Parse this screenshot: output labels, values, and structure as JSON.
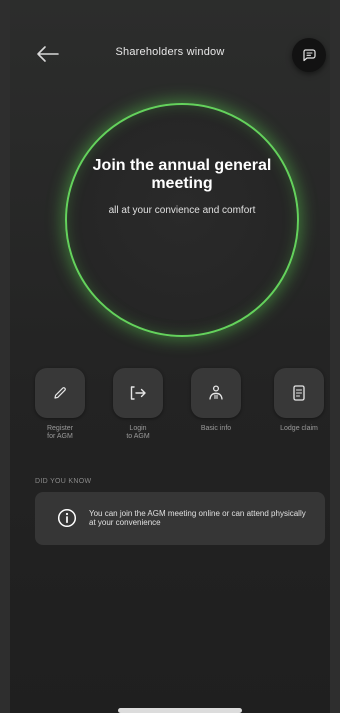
{
  "header": {
    "title": "Shareholders window",
    "back_icon": "arrow-left-icon",
    "chat_icon": "message-square-icon"
  },
  "hero": {
    "title": "Join the annual general meeting",
    "subtitle": "all at your convience and comfort",
    "ring_color": "#64d25c"
  },
  "actions": [
    {
      "label": "Register\nfor AGM",
      "icon": "pencil-icon"
    },
    {
      "label": "Login\nto AGM",
      "icon": "login-arrow-icon"
    },
    {
      "label": "Basic info",
      "icon": "user-info-icon"
    },
    {
      "label": "Lodge claim",
      "icon": "document-icon"
    }
  ],
  "did_you_know": {
    "heading": "DID YOU KNOW",
    "text": "You can join the AGM meeting online or can attend physically at your convenience",
    "icon": "info-icon"
  }
}
